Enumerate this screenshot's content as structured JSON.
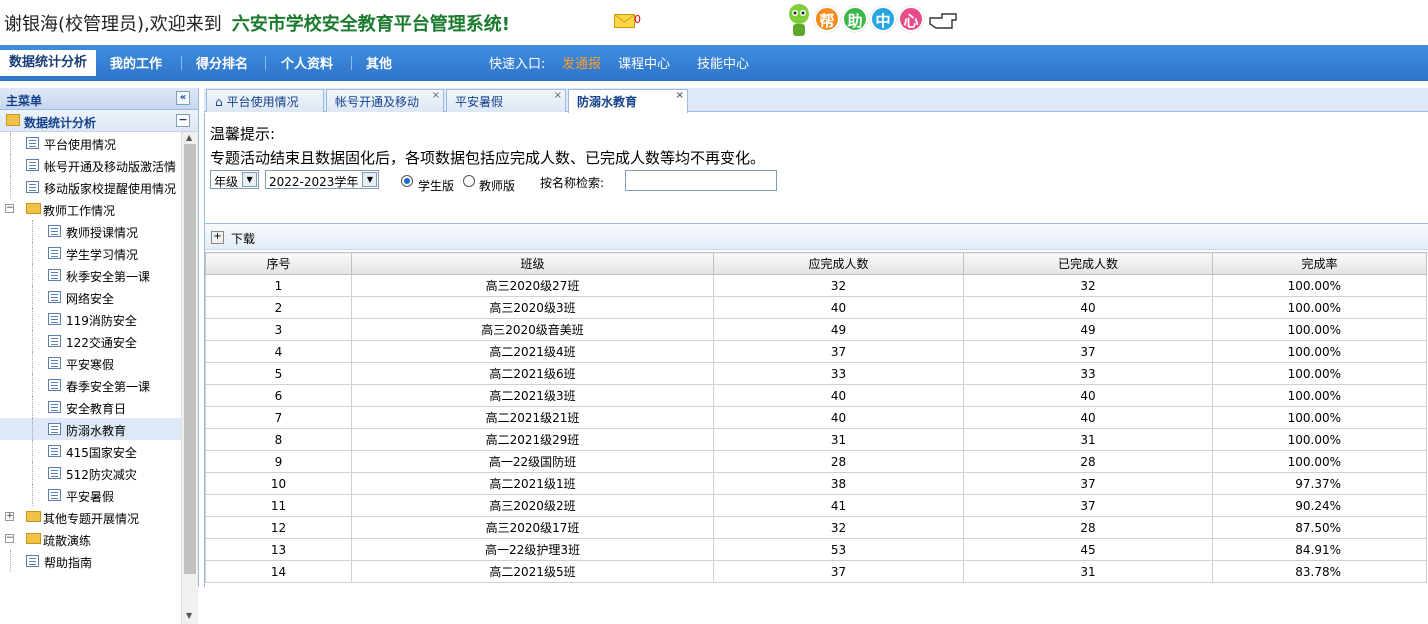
{
  "header": {
    "welcome": "谢银海(校管理员),欢迎来到",
    "system_title": "六安市学校安全教育平台管理系统!",
    "mail_count": "0",
    "help_chars": [
      "帮",
      "助",
      "中",
      "心"
    ],
    "help_colors": [
      "#f28c1e",
      "#3cb84a",
      "#27a6e0",
      "#e84b8a"
    ]
  },
  "nav": {
    "items": [
      "数据统计分析",
      "我的工作",
      "得分排名",
      "个人资料",
      "其他"
    ],
    "quick_label": "快速入口:",
    "quick_links": [
      "发通报",
      "课程中心",
      "技能中心"
    ]
  },
  "sidebar": {
    "title": "主菜单",
    "collapse_glyph": "«",
    "root": "数据统计分析",
    "root_toggle": "−",
    "items": [
      {
        "label": "平台使用情况",
        "kind": "page",
        "level": 1
      },
      {
        "label": "帐号开通及移动版激活情",
        "kind": "page",
        "level": 1
      },
      {
        "label": "移动版家校提醒使用情况",
        "kind": "page",
        "level": 1
      },
      {
        "label": "教师工作情况",
        "kind": "folder",
        "level": 0,
        "toggle": "−"
      },
      {
        "label": "教师授课情况",
        "kind": "page",
        "level": 2
      },
      {
        "label": "学生学习情况",
        "kind": "page",
        "level": 2
      },
      {
        "label": "秋季安全第一课",
        "kind": "page",
        "level": 2
      },
      {
        "label": "网络安全",
        "kind": "page",
        "level": 2
      },
      {
        "label": "119消防安全",
        "kind": "page",
        "level": 2
      },
      {
        "label": "122交通安全",
        "kind": "page",
        "level": 2
      },
      {
        "label": "平安寒假",
        "kind": "page",
        "level": 2
      },
      {
        "label": "春季安全第一课",
        "kind": "page",
        "level": 2
      },
      {
        "label": "安全教育日",
        "kind": "page",
        "level": 2
      },
      {
        "label": "防溺水教育",
        "kind": "page",
        "level": 2,
        "selected": true
      },
      {
        "label": "415国家安全",
        "kind": "page",
        "level": 2
      },
      {
        "label": "512防灾减灾",
        "kind": "page",
        "level": 2
      },
      {
        "label": "平安暑假",
        "kind": "page",
        "level": 2
      },
      {
        "label": "其他专题开展情况",
        "kind": "folder",
        "level": 0,
        "toggle": "+"
      },
      {
        "label": "疏散演练",
        "kind": "folder",
        "level": 0,
        "toggle": "−"
      },
      {
        "label": "帮助指南",
        "kind": "page",
        "level": 1
      }
    ]
  },
  "tabs": [
    {
      "label": "平台使用情况",
      "home": true,
      "closable": false
    },
    {
      "label": "帐号开通及移动",
      "closable": true
    },
    {
      "label": "平安暑假",
      "closable": true
    },
    {
      "label": "防溺水教育",
      "closable": true,
      "active": true
    }
  ],
  "tab_close_glyph": "×",
  "home_glyph": "⌂",
  "content": {
    "tip_title": "温馨提示:",
    "tip_text": "专题活动结束且数据固化后，各项数据包括应完成人数、已完成人数等均不再变化。",
    "grade_select": "年级",
    "year_select": "2022-2023学年",
    "dd_glyph": "▼",
    "radio_student": "学生版",
    "radio_teacher": "教师版",
    "search_label": "按名称检索:",
    "search_value": "",
    "download_glyph": "+",
    "download": "下载"
  },
  "table": {
    "headers": [
      "序号",
      "班级",
      "应完成人数",
      "已完成人数",
      "完成率"
    ],
    "rows": [
      [
        "1",
        "高三2020级27班",
        "32",
        "32",
        "100.00%"
      ],
      [
        "2",
        "高三2020级3班",
        "40",
        "40",
        "100.00%"
      ],
      [
        "3",
        "高三2020级音美班",
        "49",
        "49",
        "100.00%"
      ],
      [
        "4",
        "高二2021级4班",
        "37",
        "37",
        "100.00%"
      ],
      [
        "5",
        "高二2021级6班",
        "33",
        "33",
        "100.00%"
      ],
      [
        "6",
        "高二2021级3班",
        "40",
        "40",
        "100.00%"
      ],
      [
        "7",
        "高二2021级21班",
        "40",
        "40",
        "100.00%"
      ],
      [
        "8",
        "高二2021级29班",
        "31",
        "31",
        "100.00%"
      ],
      [
        "9",
        "高一22级国防班",
        "28",
        "28",
        "100.00%"
      ],
      [
        "10",
        "高二2021级1班",
        "38",
        "37",
        "97.37%"
      ],
      [
        "11",
        "高三2020级2班",
        "41",
        "37",
        "90.24%"
      ],
      [
        "12",
        "高三2020级17班",
        "32",
        "28",
        "87.50%"
      ],
      [
        "13",
        "高一22级护理3班",
        "53",
        "45",
        "84.91%"
      ],
      [
        "14",
        "高二2021级5班",
        "37",
        "31",
        "83.78%"
      ]
    ]
  }
}
